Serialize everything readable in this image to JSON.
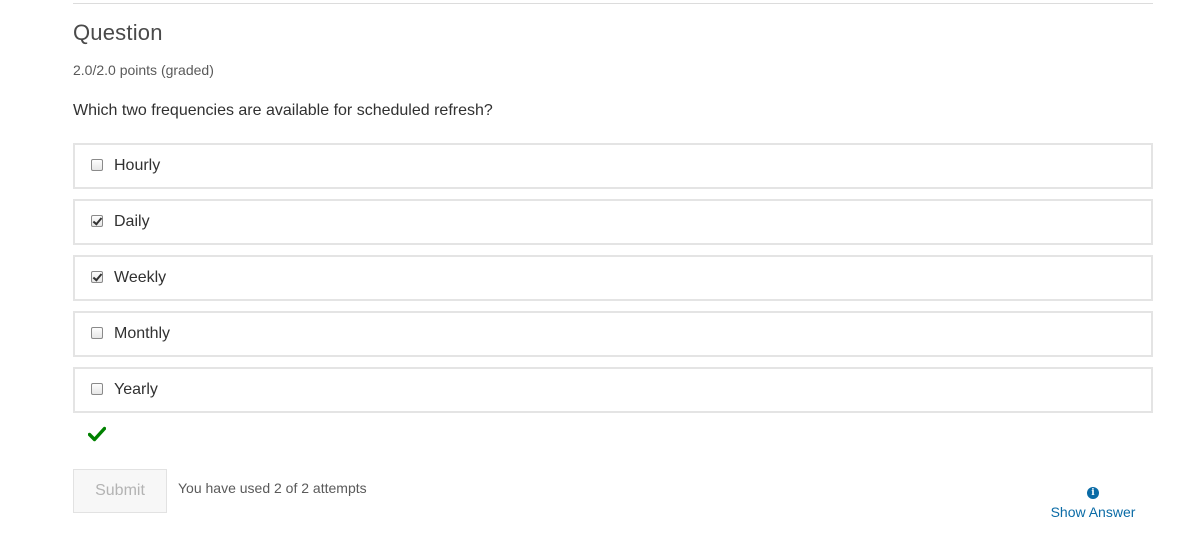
{
  "question": {
    "title": "Question",
    "points": "2.0/2.0 points (graded)",
    "prompt": "Which two frequencies are available for scheduled refresh?"
  },
  "choices": [
    {
      "label": "Hourly",
      "checked": false
    },
    {
      "label": "Daily",
      "checked": true
    },
    {
      "label": "Weekly",
      "checked": true
    },
    {
      "label": "Monthly",
      "checked": false
    },
    {
      "label": "Yearly",
      "checked": false
    }
  ],
  "status": {
    "icon": "checkmark-icon",
    "color": "#008100"
  },
  "actions": {
    "submit_label": "Submit",
    "attempts_text": "You have used 2 of 2 attempts",
    "show_answer_label": "Show Answer",
    "show_answer_icon": "info-icon",
    "link_color": "#0a6ba6"
  }
}
